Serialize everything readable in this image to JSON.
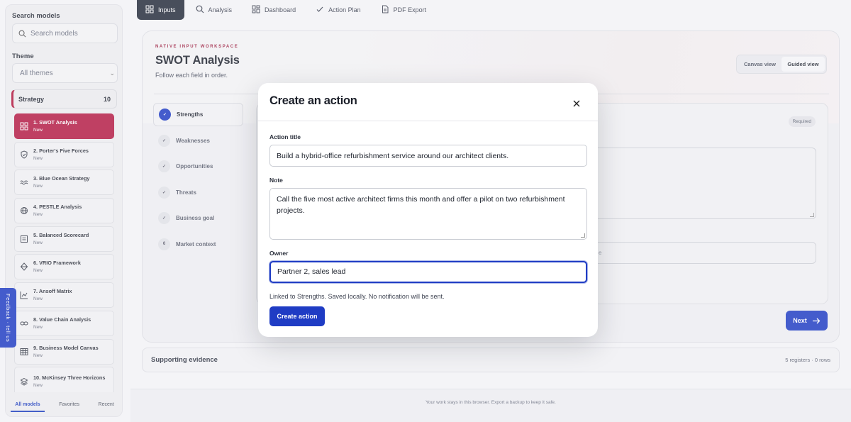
{
  "sidebar": {
    "search_label": "Search models",
    "search_placeholder": "Search models",
    "theme_label": "Theme",
    "theme_value": "All themes",
    "category": {
      "name": "Strategy",
      "count": "10"
    },
    "models": [
      {
        "label": "1. SWOT Analysis",
        "status": "New",
        "icon": "grid-icon",
        "active": true
      },
      {
        "label": "2. Porter's Five Forces",
        "status": "New",
        "icon": "shield-icon"
      },
      {
        "label": "3. Blue Ocean Strategy",
        "status": "New",
        "icon": "waves-icon"
      },
      {
        "label": "4. PESTLE Analysis",
        "status": "New",
        "icon": "globe-icon"
      },
      {
        "label": "5. Balanced Scorecard",
        "status": "New",
        "icon": "scorecard-icon"
      },
      {
        "label": "6. VRIO Framework",
        "status": "New",
        "icon": "diamond-icon"
      },
      {
        "label": "7. Ansoff Matrix",
        "status": "New",
        "icon": "trend-chart-icon"
      },
      {
        "label": "8. Value Chain Analysis",
        "status": "New",
        "icon": "link-icon"
      },
      {
        "label": "9. Business Model Canvas",
        "status": "New",
        "icon": "table-icon"
      },
      {
        "label": "10. McKinsey Three Horizons",
        "status": "New",
        "icon": "layers-icon"
      }
    ],
    "tabs": [
      "All models",
      "Favorites",
      "Recent"
    ]
  },
  "feedback_label": "Feedback · tell us",
  "topnav": [
    {
      "label": "Inputs",
      "icon": "grid-icon",
      "active": true
    },
    {
      "label": "Analysis",
      "icon": "search-icon"
    },
    {
      "label": "Dashboard",
      "icon": "dashboard-icon"
    },
    {
      "label": "Action Plan",
      "icon": "check-icon"
    },
    {
      "label": "PDF Export",
      "icon": "document-icon"
    }
  ],
  "workspace": {
    "eyebrow": "NATIVE INPUT WORKSPACE",
    "title": "SWOT Analysis",
    "subtitle": "Follow each field in order.",
    "views": [
      "Canvas view",
      "Guided view"
    ],
    "steps": [
      {
        "label": "Strengths",
        "marker": "✓",
        "active": true
      },
      {
        "label": "Weaknesses",
        "marker": "✓"
      },
      {
        "label": "Opportunities",
        "marker": "✓"
      },
      {
        "label": "Threats",
        "marker": "✓"
      },
      {
        "label": "Business goal",
        "marker": "✓"
      },
      {
        "label": "Market context",
        "marker": "6"
      }
    ],
    "required_badge": "Required",
    "partial_placeholder": "e",
    "next_label": "Next"
  },
  "evidence": {
    "title": "Supporting evidence",
    "meta": "5 registers · 0 rows"
  },
  "footer_text": "Your work stays in this browser. Export a backup to keep it safe.",
  "modal": {
    "title": "Create an action",
    "action_title_label": "Action title",
    "action_title_value": "Build a hybrid-office refurbishment service around our architect clients.",
    "note_label": "Note",
    "note_value": "Call the five most active architect firms this month and offer a pilot on two refurbishment projects.",
    "owner_label": "Owner",
    "owner_value": "Partner 2, sales lead",
    "linked_text": "Linked to Strengths. Saved locally. No notification will be sent.",
    "create_label": "Create action"
  },
  "colors": {
    "accent": "#1f3cc4",
    "brand": "#b51a44",
    "nav_dark": "#242b3a"
  }
}
